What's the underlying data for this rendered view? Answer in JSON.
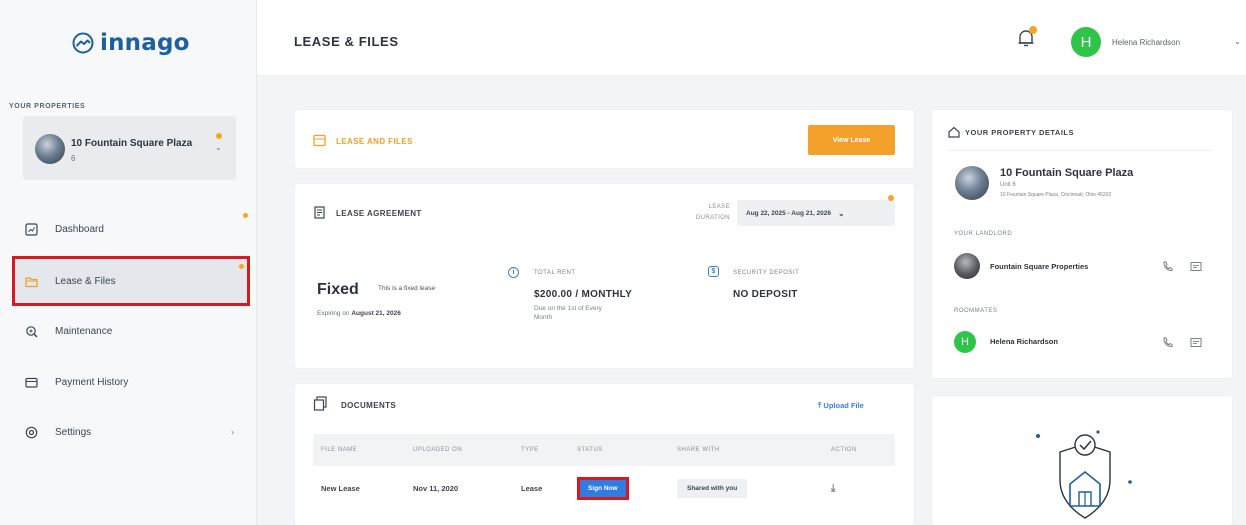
{
  "brand": {
    "name": "innago",
    "color": "#1d5fa0"
  },
  "sidebar": {
    "properties_label": "YOUR PROPERTIES",
    "property": {
      "name": "10 Fountain Square Plaza",
      "unit": "6"
    },
    "items": [
      {
        "label": "Dashboard",
        "icon": "dashboard-icon",
        "badge": true
      },
      {
        "label": "Lease & Files",
        "icon": "folder-icon",
        "badge": true,
        "active": true
      },
      {
        "label": "Maintenance",
        "icon": "maintenance-icon"
      },
      {
        "label": "Payment History",
        "icon": "card-icon"
      },
      {
        "label": "Settings",
        "icon": "gear-icon",
        "caret": "›"
      }
    ]
  },
  "header": {
    "title": "LEASE & FILES",
    "user": {
      "initial": "H",
      "name": "Helena Richardson"
    }
  },
  "lease_files_card": {
    "title": "LEASE AND FILES",
    "button": "View Lease"
  },
  "agreement": {
    "title": "LEASE AGREEMENT",
    "duration_label_1": "LEASE",
    "duration_label_2": "DURATION",
    "duration_value": "Aug 22, 2025 - Aug 21, 2026",
    "type": "Fixed",
    "type_desc": "This is a fixed lease",
    "expiring_prefix": "Expiring on",
    "expiring_date": "August 21, 2026",
    "rent": {
      "label": "TOTAL RENT",
      "value": "$200.00 / MONTHLY",
      "sub": "Due on the 1st of Every Month"
    },
    "deposit": {
      "label": "SECURITY DEPOSIT",
      "value": "NO DEPOSIT"
    }
  },
  "documents": {
    "title": "DOCUMENTS",
    "upload": "Upload File",
    "columns": [
      "FILE NAME",
      "UPLOADED ON",
      "TYPE",
      "STATUS",
      "SHARE WITH",
      "ACTION"
    ],
    "rows": [
      {
        "file": "New Lease",
        "uploaded": "Nov 11, 2020",
        "type": "Lease",
        "status": "Sign Now",
        "share": "Shared with you"
      }
    ]
  },
  "property_details": {
    "title": "YOUR PROPERTY DETAILS",
    "name": "10 Fountain Square Plaza",
    "unit": "Unit 6",
    "address": "10 Fountain Square Plaza, Cincinnati, Ohio 45202",
    "landlord_label": "YOUR LANDLORD",
    "landlord": "Fountain Square Properties",
    "roommates_label": "ROOMMATES",
    "roommate": {
      "initial": "H",
      "name": "Helena Richardson"
    }
  },
  "colors": {
    "accent": "#f3a12a",
    "primary": "#2f7de1",
    "highlight": "#d71920",
    "avatar_green": "#2ec44a"
  }
}
